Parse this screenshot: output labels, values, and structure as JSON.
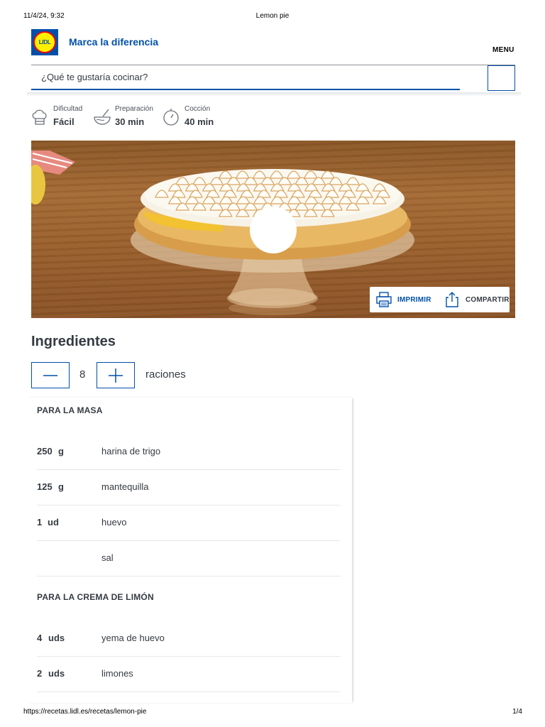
{
  "print_header": {
    "datetime": "11/4/24, 9:32",
    "doc_title": "Lemon pie"
  },
  "brand": {
    "logo_text": "LIDL",
    "tagline": "Marca la diferencia",
    "menu_label": "MENU"
  },
  "search": {
    "placeholder": "¿Qué te gustaría cocinar?",
    "value": ""
  },
  "recipe_meta": [
    {
      "label": "Dificultad",
      "value": "Fácil",
      "icon": "chef-hat-icon"
    },
    {
      "label": "Preparación",
      "value": "30 min",
      "icon": "mixing-bowl-icon"
    },
    {
      "label": "Cocción",
      "value": "40 min",
      "icon": "timer-icon"
    }
  ],
  "hero_actions": {
    "print_label": "IMPRIMIR",
    "share_label": "COMPARTIR"
  },
  "ingredients": {
    "title": "Ingredientes",
    "portions": {
      "count": "8",
      "unit": "raciones"
    },
    "sections": [
      {
        "title": "PARA LA MASA",
        "items": [
          {
            "qty": "250",
            "unit": "g",
            "name": "harina de trigo"
          },
          {
            "qty": "125",
            "unit": "g",
            "name": "mantequilla"
          },
          {
            "qty": "1",
            "unit": "ud",
            "name": "huevo"
          },
          {
            "qty": "",
            "unit": "",
            "name": "sal"
          }
        ]
      },
      {
        "title": "PARA LA CREMA DE LIMÓN",
        "items": [
          {
            "qty": "4",
            "unit": "uds",
            "name": "yema de huevo"
          },
          {
            "qty": "2",
            "unit": "uds",
            "name": "limones"
          }
        ]
      }
    ]
  },
  "print_footer": {
    "url": "https://recetas.lidl.es/recetas/lemon-pie",
    "page": "1/4"
  },
  "colors": {
    "brand_blue": "#0050aa",
    "brand_yellow": "#fff000",
    "brand_red": "#e60a14",
    "text": "#353b42"
  }
}
